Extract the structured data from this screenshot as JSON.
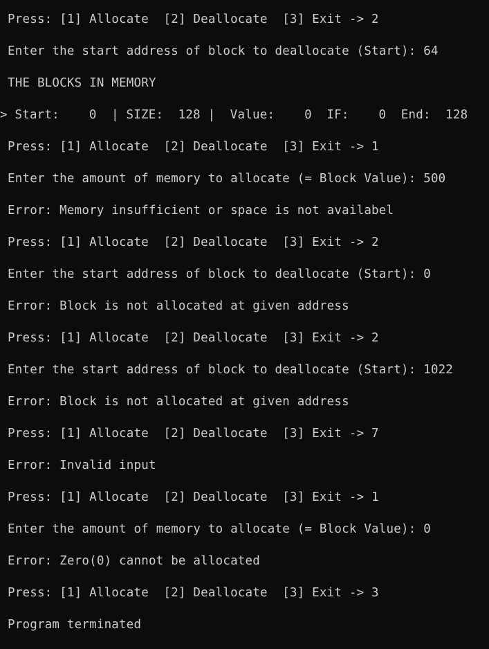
{
  "terminal": {
    "lines": [
      "Press: [1] Allocate  [2] Deallocate  [3] Exit -> 2",
      "Enter the start address of block to deallocate (Start): 64",
      "THE BLOCKS IN MEMORY",
      "> Start:    0  | SIZE:  128 |  Value:    0  IF:    0  End:  128",
      "Press: [1] Allocate  [2] Deallocate  [3] Exit -> 1",
      "Enter the amount of memory to allocate (= Block Value): 500",
      "Error: Memory insufficient or space is not availabel",
      "Press: [1] Allocate  [2] Deallocate  [3] Exit -> 2",
      "Enter the start address of block to deallocate (Start): 0",
      "Error: Block is not allocated at given address",
      "Press: [1] Allocate  [2] Deallocate  [3] Exit -> 2",
      "Enter the start address of block to deallocate (Start): 1022",
      "Error: Block is not allocated at given address",
      "Press: [1] Allocate  [2] Deallocate  [3] Exit -> 7",
      "Error: Invalid input",
      "Press: [1] Allocate  [2] Deallocate  [3] Exit -> 1",
      "Enter the amount of memory to allocate (= Block Value): 0",
      "Error: Zero(0) cannot be allocated",
      "Press: [1] Allocate  [2] Deallocate  [3] Exit -> 3",
      "Program terminated"
    ]
  },
  "colors": {
    "background": "#0c0c0c",
    "text": "#cccccc"
  }
}
